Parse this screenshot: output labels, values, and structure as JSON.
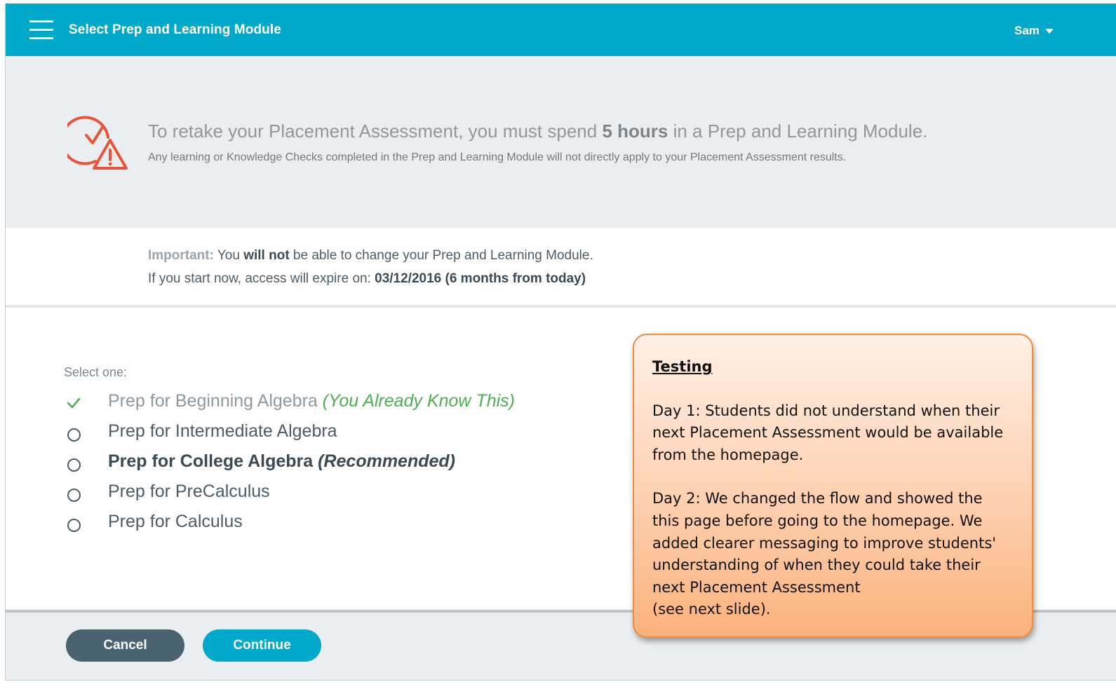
{
  "header": {
    "title": "Select Prep and Learning Module",
    "user_name": "Sam"
  },
  "banner": {
    "main_prefix": "To retake your Placement Assessment, you must spend ",
    "main_bold": "5 hours",
    "main_suffix": " in a Prep and Learning Module.",
    "sub": "Any learning or Knowledge Checks completed in the Prep and Learning Module will not directly apply to your Placement Assessment results."
  },
  "important": {
    "label": "Important:",
    "line1_a": " You ",
    "line1_bold": "will not",
    "line1_b": " be able to change your Prep and Learning Module.",
    "line2_prefix": "If you start now, access will expire on: ",
    "line2_bold": "03/12/2016 (6 months from today)"
  },
  "selection": {
    "label": "Select one:",
    "options": [
      {
        "label": "Prep for Beginning Algebra",
        "note": "(You Already Know This)",
        "state": "completed"
      },
      {
        "label": "Prep for Intermediate Algebra",
        "note": "",
        "state": "unselected"
      },
      {
        "label": "Prep for College Algebra",
        "note": "(Recommended)",
        "state": "unselected"
      },
      {
        "label": "Prep for PreCalculus",
        "note": "",
        "state": "unselected"
      },
      {
        "label": "Prep for Calculus",
        "note": "",
        "state": "unselected"
      }
    ]
  },
  "footer": {
    "cancel_label": "Cancel",
    "continue_label": "Continue"
  },
  "note": {
    "title": "Testing",
    "para1": "Day 1: Students did not understand when their next Placement Assessment would be available from the homepage.",
    "para2": "Day 2: We changed the flow and showed the this page before going to the homepage.  We added clearer messaging to improve students' understanding of when they could take their next Placement Assessment",
    "para3": "(see next slide)."
  },
  "colors": {
    "header_bg": "#00a9c9",
    "banner_bg": "#ebeef0",
    "warning_icon": "#e8533a",
    "check_green": "#4caf50",
    "cancel_bg": "#4a6370",
    "continue_bg": "#00a9c9",
    "note_border": "#f08a3c"
  },
  "icons": {
    "menu": "hamburger-icon",
    "caret": "caret-down-icon",
    "warning": "clock-warning-icon",
    "check": "check-icon",
    "radio": "radio-icon"
  }
}
